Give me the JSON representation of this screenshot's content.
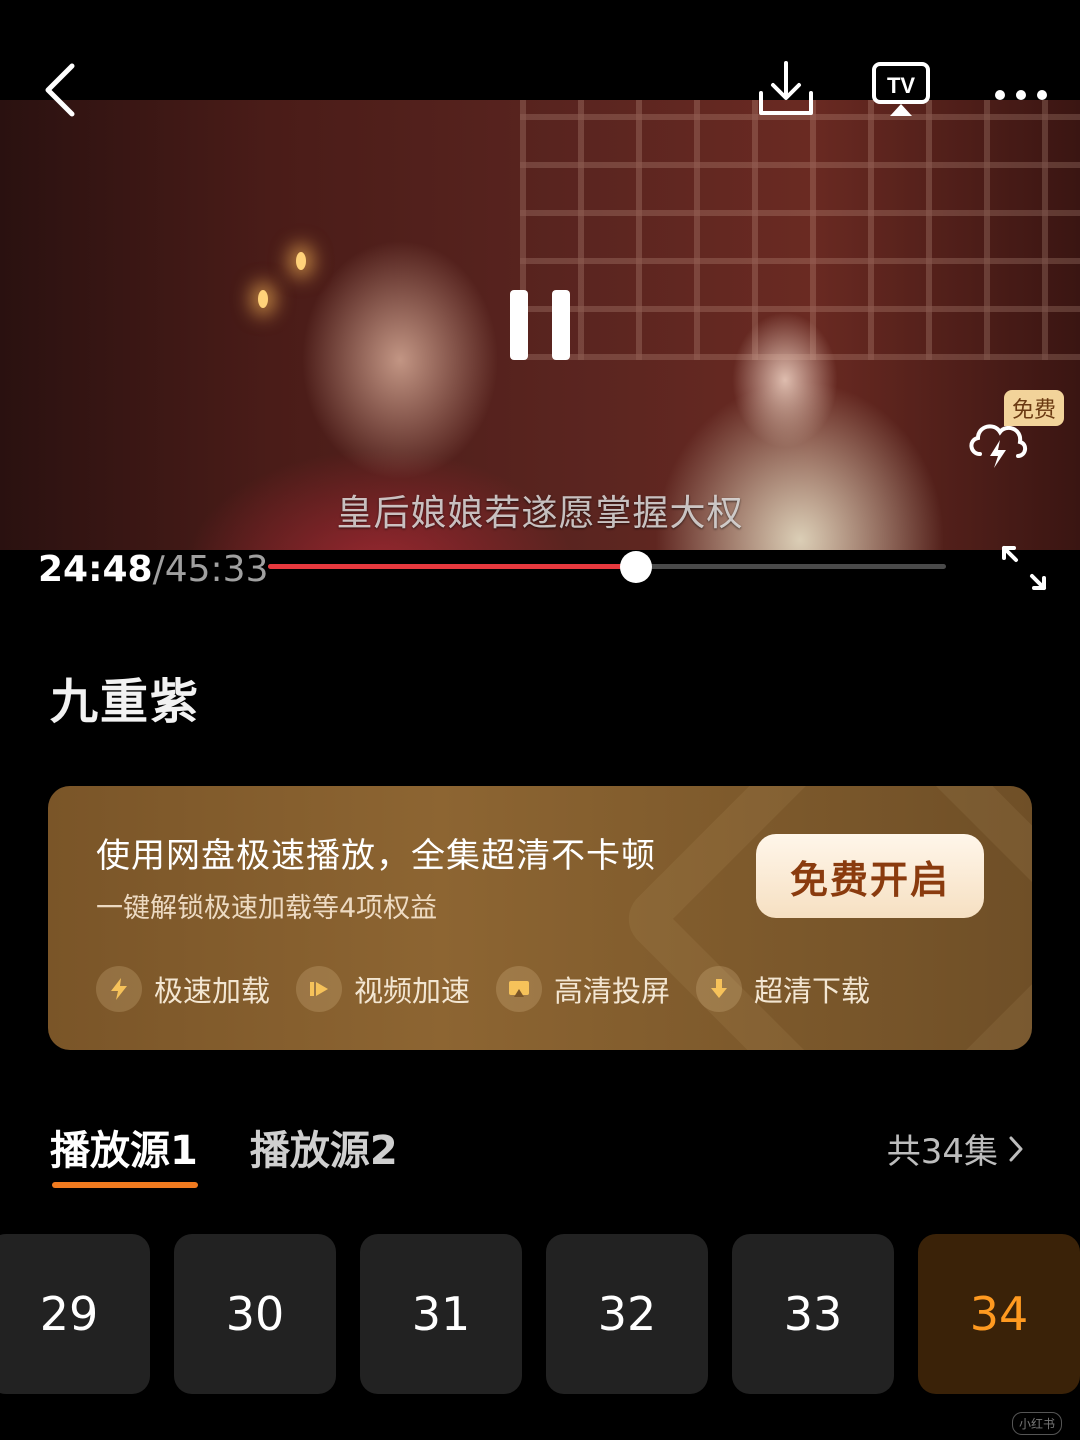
{
  "player": {
    "subtitle": "皇后娘娘若遂愿掌握大权",
    "current_time": "24:48",
    "separator": "/",
    "total_time": "45:33",
    "progress": 0.543,
    "free_badge": "免费",
    "icons": [
      "back-arrow-icon",
      "download-icon",
      "tv-cast-icon",
      "more-icon",
      "pause-icon",
      "cloud-accelerate-icon",
      "fullscreen-icon"
    ],
    "progress_color": "#e8393e"
  },
  "show": {
    "title": "九重紫"
  },
  "promo": {
    "headline": "使用网盘极速播放，全集超清不卡顿",
    "sub": "一键解锁极速加载等4项权益",
    "button_label": "免费开启",
    "features": [
      {
        "label": "极速加载",
        "icon": "lightning-icon"
      },
      {
        "label": "视频加速",
        "icon": "fast-forward-icon"
      },
      {
        "label": "高清投屏",
        "icon": "cast-screen-icon"
      },
      {
        "label": "超清下载",
        "icon": "download-arrow-icon"
      }
    ],
    "background_color": "#7e5a2c"
  },
  "sources": {
    "tabs": [
      {
        "label": "播放源1"
      },
      {
        "label": "播放源2"
      }
    ],
    "active_index": 0,
    "episode_count": "共34集",
    "accent_color": "#f07a1f"
  },
  "episodes": [
    "29",
    "30",
    "31",
    "32",
    "33",
    "34"
  ],
  "selected_episode": "34",
  "watermark": "小红书"
}
